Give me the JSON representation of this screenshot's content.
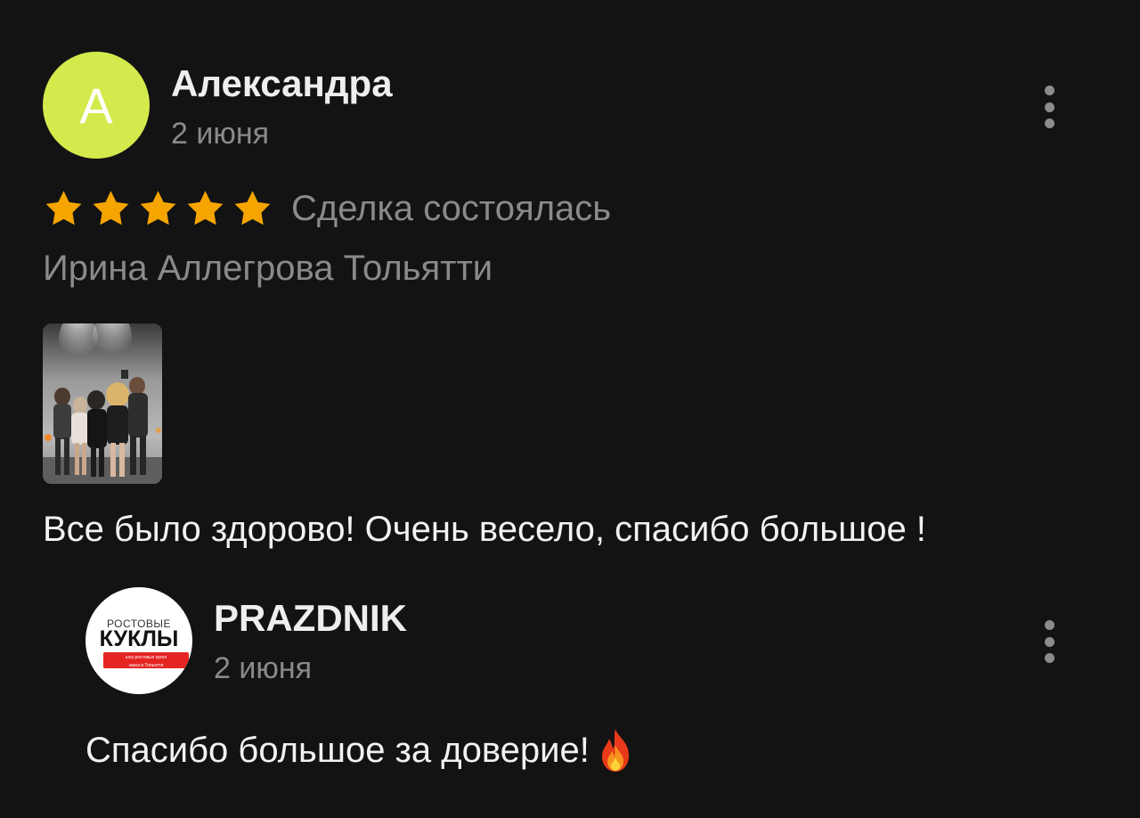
{
  "review": {
    "avatar_letter": "А",
    "avatar_color": "#d4e94c",
    "author": "Александра",
    "date": "2 июня",
    "rating": 5,
    "rating_max": 5,
    "star_color": "#f5a400",
    "deal_status": "Сделка состоялась",
    "service_title": "Ирина Аллегрова Тольятти",
    "text": "Все было здорово! Очень весело, спасибо большое !"
  },
  "reply": {
    "avatar_logo": {
      "top_line": "РОСТОВЫЕ",
      "main_word": "КУКЛЫ",
      "band_line_1": "шоу ростовых кукол",
      "band_line_2": "заказ в Тольятти",
      "band_color": "#e52521"
    },
    "author": "PRAZDNIK",
    "date": "2 июня",
    "text": "Спасибо большое за доверие!",
    "emoji_icon": "fire-icon"
  },
  "colors": {
    "background": "#131313",
    "primary_text": "#f2f2f2",
    "secondary_text": "#8a8a8a"
  }
}
